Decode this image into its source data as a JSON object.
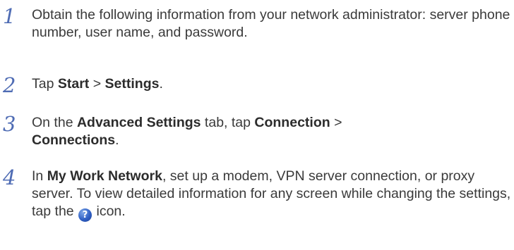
{
  "steps": [
    {
      "number": "1",
      "text": "Obtain the following information from your network administrator: server phone number, user name, and password."
    },
    {
      "number": "2",
      "parts": {
        "t1": "Tap ",
        "b1": "Start",
        "t2": " > ",
        "b2": "Settings",
        "t3": "."
      }
    },
    {
      "number": "3",
      "parts": {
        "t1": "On the ",
        "b1": "Advanced Settings",
        "t2": " tab, tap ",
        "b2": "Connection",
        "t3": " > ",
        "b3": "Connections",
        "t4": "."
      }
    },
    {
      "number": "4",
      "parts": {
        "t1": "In ",
        "b1": "My Work Network",
        "t2": ", set up a modem, VPN server connection, or proxy server. To view detailed information for any screen while changing the settings, tap the ",
        "t3": " icon."
      },
      "icon": "help-icon",
      "icon_glyph": "?"
    }
  ]
}
